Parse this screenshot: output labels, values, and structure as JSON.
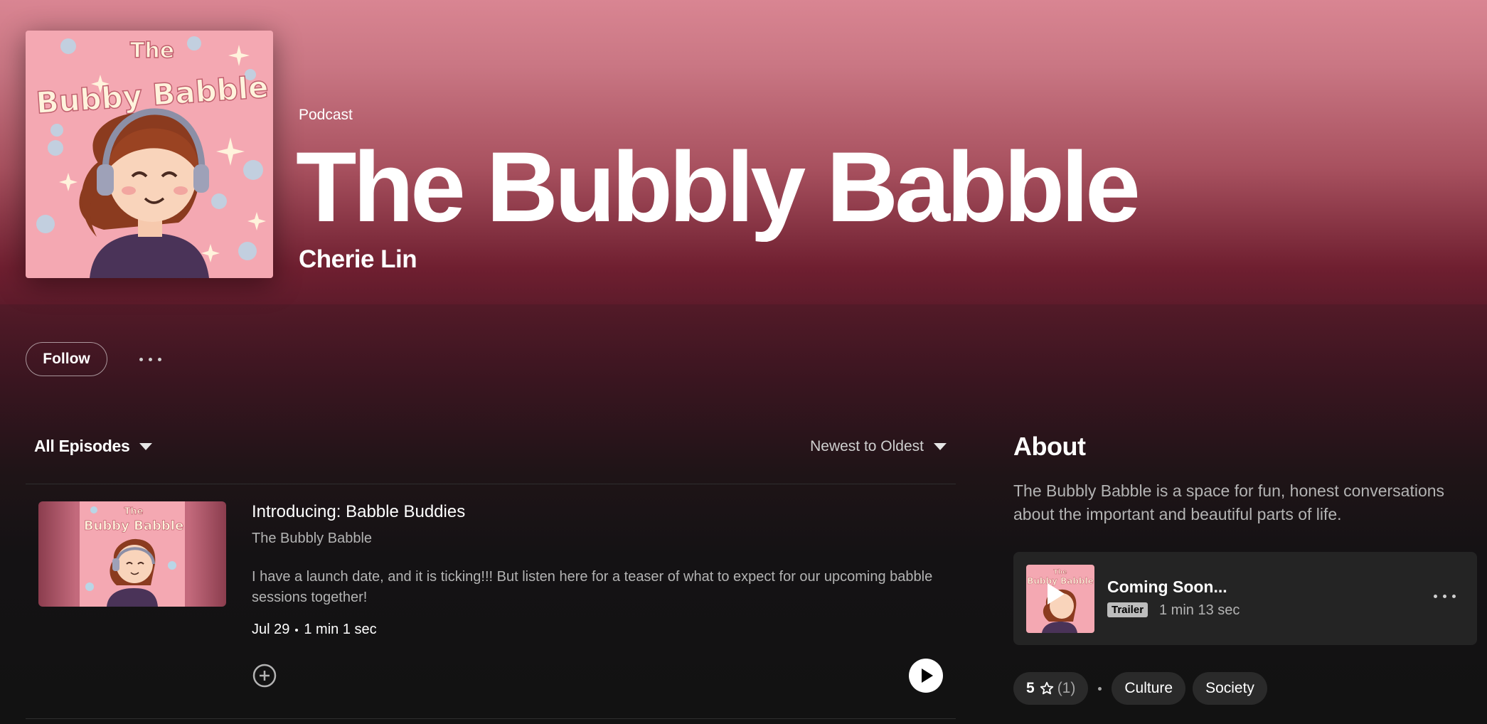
{
  "header": {
    "kind": "Podcast",
    "title": "The Bubbly Babble",
    "author": "Cherie Lin",
    "cover_text_line1": "The",
    "cover_text_line2": "Bubby Babble"
  },
  "actions": {
    "follow_label": "Follow",
    "more_icon": "more-horizontal-icon"
  },
  "episodes": {
    "filter_label": "All Episodes",
    "sort_label": "Newest to Oldest",
    "items": [
      {
        "title": "Introducing: Babble Buddies",
        "show": "The Bubbly Babble",
        "description": "I have a launch date, and it is ticking!!! But listen here for a teaser of what to expect for our upcoming babble sessions together!",
        "date": "Jul 29",
        "duration": "1 min 1 sec"
      }
    ]
  },
  "about": {
    "heading": "About",
    "text": "The Bubbly Babble is a space for fun, honest conversations about the important and beautiful parts of life.",
    "trailer": {
      "title": "Coming Soon...",
      "badge": "Trailer",
      "duration": "1 min 13 sec"
    },
    "rating": "5",
    "rating_count": "(1)",
    "tags": [
      "Culture",
      "Society"
    ]
  },
  "colors": {
    "hero_top": "#d98592",
    "hero_bottom": "#5e1b2b",
    "background": "#121212",
    "card": "#242424",
    "muted_text": "#b3b3b3"
  }
}
